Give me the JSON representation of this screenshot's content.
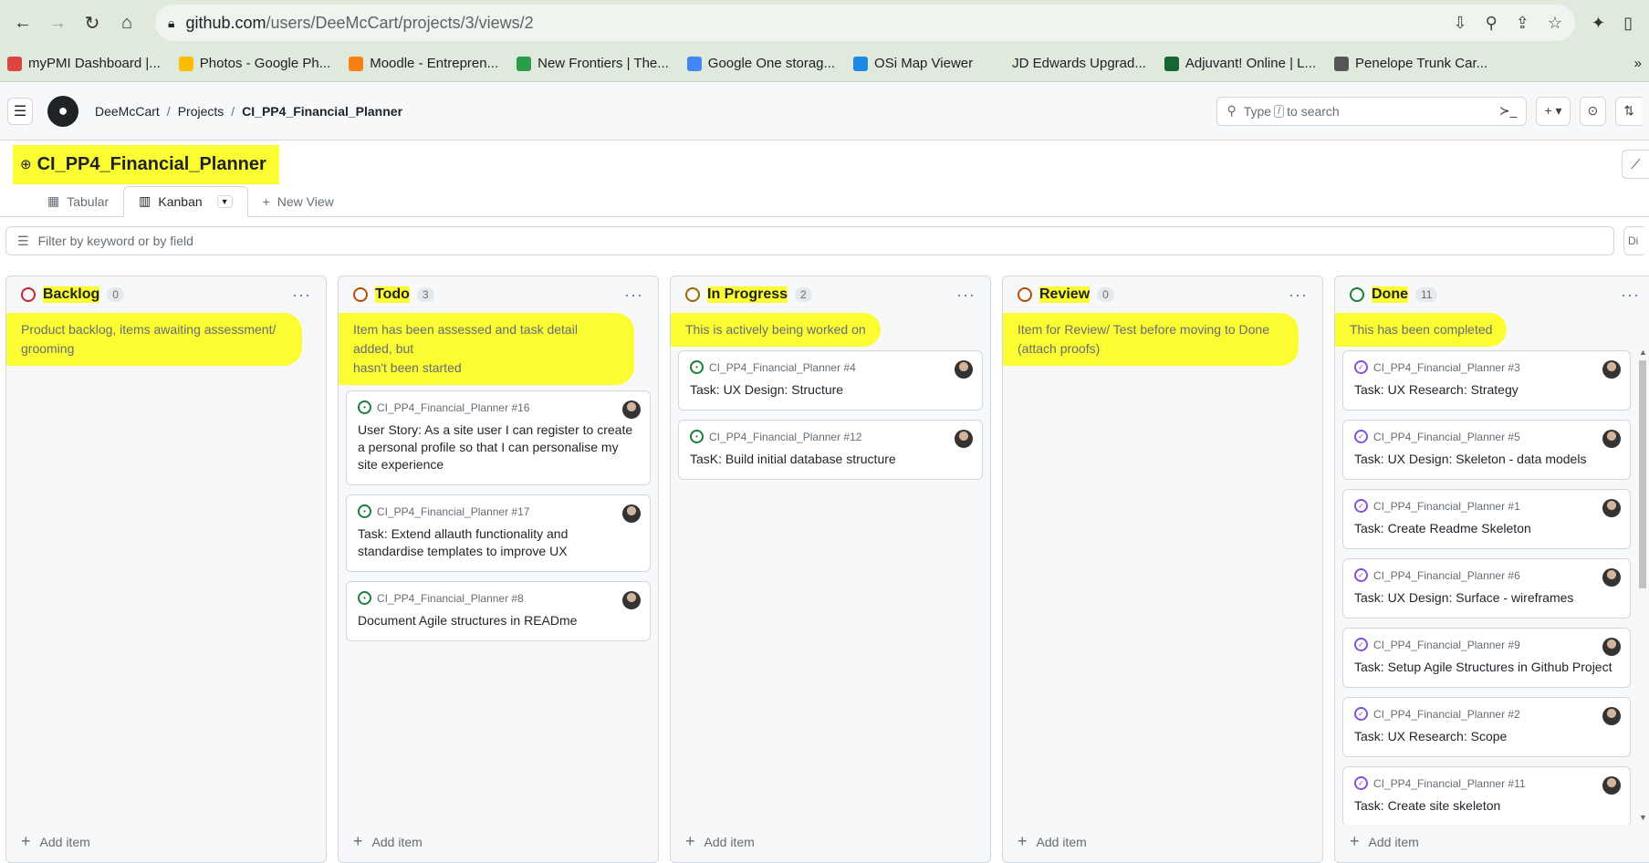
{
  "browser": {
    "url_host": "github.com",
    "url_path": "/users/DeeMcCart/projects/3/views/2",
    "bookmarks": [
      {
        "label": "myPMI Dashboard |...",
        "color": "#d44"
      },
      {
        "label": "Photos - Google Ph...",
        "color": "#fbbc05"
      },
      {
        "label": "Moodle - Entrepren...",
        "color": "#f98012"
      },
      {
        "label": "New Frontiers | The...",
        "color": "#2a9d4a"
      },
      {
        "label": "Google One storag...",
        "color": "#4285f4"
      },
      {
        "label": "OSi Map Viewer",
        "color": "#1e88e5"
      },
      {
        "label": "JD Edwards Upgrad...",
        "color": "#dfe9dc"
      },
      {
        "label": "Adjuvant! Online | L...",
        "color": "#166534"
      },
      {
        "label": "Penelope Trunk Car...",
        "color": "#555"
      }
    ],
    "more_label": "»"
  },
  "header": {
    "crumbs": [
      "DeeMcCart",
      "Projects",
      "CI_PP4_Financial_Planner"
    ],
    "search_prefix": "Type",
    "search_key": "/",
    "search_suffix": "to search",
    "plus_label": "+ ▾"
  },
  "project": {
    "title": "CI_PP4_Financial_Planner",
    "views": [
      {
        "label": "Tabular",
        "active": false
      },
      {
        "label": "Kanban",
        "active": true
      }
    ],
    "new_view_label": "New View",
    "filter_placeholder": "Filter by keyword or by field",
    "filter_side": "Di"
  },
  "columns": [
    {
      "name": "Backlog",
      "count": "0",
      "color": "#cf222e",
      "desc_line1": "Product backlog, items awaiting assessment/",
      "desc_line2": "grooming",
      "cards": []
    },
    {
      "name": "Todo",
      "count": "3",
      "color": "#bc4c00",
      "desc_line1": "Item has been assessed and task detail added, but",
      "desc_line2": "hasn't been started",
      "cards": [
        {
          "ref": "CI_PP4_Financial_Planner #16",
          "title": "User Story: As a site user I can register to create a personal profile so that I can personalise my site experience",
          "state": "open"
        },
        {
          "ref": "CI_PP4_Financial_Planner #17",
          "title": "Task: Extend allauth functionality and standardise templates to improve UX",
          "state": "open"
        },
        {
          "ref": "CI_PP4_Financial_Planner #8",
          "title": "Document Agile structures in READme",
          "state": "open"
        }
      ]
    },
    {
      "name": "In Progress",
      "count": "2",
      "color": "#9a6700",
      "desc_line1": "This is actively being worked on",
      "desc_line2": "",
      "cards": [
        {
          "ref": "CI_PP4_Financial_Planner #4",
          "title": "Task: UX Design: Structure",
          "state": "open"
        },
        {
          "ref": "CI_PP4_Financial_Planner #12",
          "title": "TasK: Build initial database structure",
          "state": "open"
        }
      ]
    },
    {
      "name": "Review",
      "count": "0",
      "color": "#bc4c00",
      "desc_line1": "Item for Review/ Test before moving to Done",
      "desc_line2": "(attach proofs)",
      "cards": []
    },
    {
      "name": "Done",
      "count": "11",
      "color": "#1a7f37",
      "desc_line1": "This has been completed",
      "desc_line2": "",
      "cards": [
        {
          "ref": "CI_PP4_Financial_Planner #3",
          "title": "Task: UX Research: Strategy",
          "state": "done"
        },
        {
          "ref": "CI_PP4_Financial_Planner #5",
          "title": "Task: UX Design: Skeleton - data models",
          "state": "done"
        },
        {
          "ref": "CI_PP4_Financial_Planner #1",
          "title": "Task: Create Readme Skeleton",
          "state": "done"
        },
        {
          "ref": "CI_PP4_Financial_Planner #6",
          "title": "Task: UX Design: Surface - wireframes",
          "state": "done"
        },
        {
          "ref": "CI_PP4_Financial_Planner #9",
          "title": "Task: Setup Agile Structures in Github Project",
          "state": "done"
        },
        {
          "ref": "CI_PP4_Financial_Planner #2",
          "title": "Task: UX Research: Scope",
          "state": "done"
        },
        {
          "ref": "CI_PP4_Financial_Planner #11",
          "title": "Task: Create site skeleton",
          "state": "done"
        }
      ]
    }
  ],
  "add_item_label": "Add item"
}
